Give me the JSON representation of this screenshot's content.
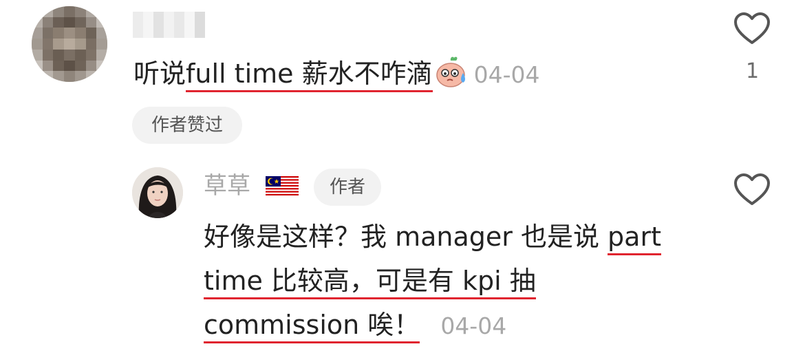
{
  "colors": {
    "text": "#222222",
    "meta": "#a8a8a8",
    "underline": "#e0242f",
    "pill_bg": "#f2f2f2"
  },
  "comment": {
    "text_prefix": "听说",
    "text_underlined": "full time 薪水不咋滴",
    "emoji": "sweat-smile-emoji",
    "date": "04-04",
    "author_liked_label": "作者赞过",
    "like_count": "1"
  },
  "reply": {
    "username": "草草",
    "flag": "malaysia-flag",
    "author_badge": "作者",
    "line1_prefix": "好像是这样？我 manager 也是说 ",
    "line1_underlined": "part",
    "line2_underlined": "time 比较高，可是有 kpi 抽",
    "line3_underlined": "commission 唉！",
    "date": "04-04"
  }
}
